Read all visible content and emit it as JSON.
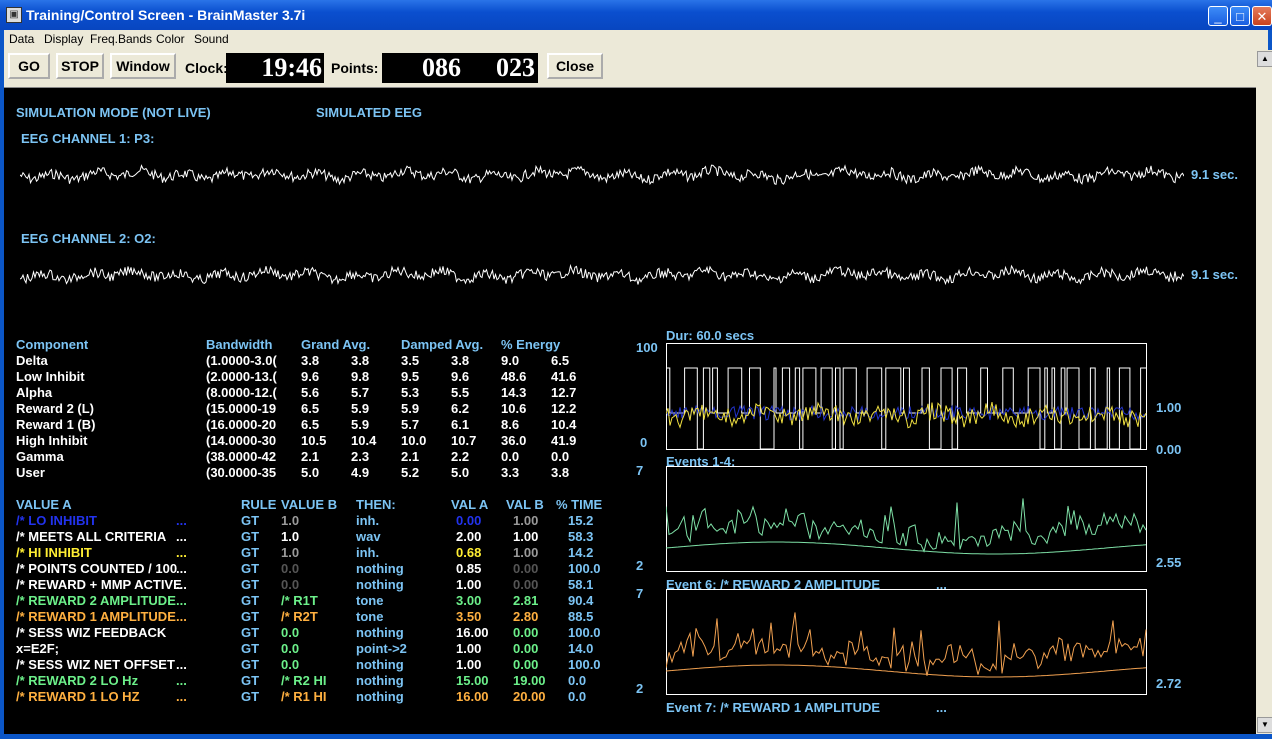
{
  "window": {
    "title": "Training/Control Screen - BrainMaster 3.7i",
    "min_glyph": "_",
    "max_glyph": "□",
    "close_glyph": "✕"
  },
  "menu": [
    "Data",
    "Display",
    "Freq.Bands",
    "Color",
    "Sound"
  ],
  "toolbar": {
    "go": "GO",
    "stop": "STOP",
    "window": "Window",
    "clock_label": "Clock:",
    "clock_value": "19:46",
    "points_label": "Points:",
    "points_a": "086",
    "points_b": "023",
    "close": "Close"
  },
  "status": {
    "mode": "SIMULATION MODE (NOT LIVE)",
    "source": "SIMULATED EEG"
  },
  "eeg": [
    {
      "label": "EEG CHANNEL 1: P3:",
      "duration": "9.1 sec."
    },
    {
      "label": "EEG CHANNEL 2: O2:",
      "duration": "9.1 sec."
    }
  ],
  "components": {
    "headers": [
      "Component",
      "Bandwidth",
      "Grand Avg.",
      "Damped Avg.",
      "% Energy"
    ],
    "rows": [
      {
        "name": "Delta",
        "band": "(1.0000-3.0(",
        "ga1": "3.8",
        "ga2": "3.8",
        "da1": "3.5",
        "da2": "3.8",
        "e1": "9.0",
        "e2": "6.5"
      },
      {
        "name": "Low Inhibit",
        "band": "(2.0000-13.(",
        "ga1": "9.6",
        "ga2": "9.8",
        "da1": "9.5",
        "da2": "9.6",
        "e1": "48.6",
        "e2": "41.6"
      },
      {
        "name": "Alpha",
        "band": "(8.0000-12.(",
        "ga1": "5.6",
        "ga2": "5.7",
        "da1": "5.3",
        "da2": "5.5",
        "e1": "14.3",
        "e2": "12.7"
      },
      {
        "name": "Reward 2 (L)",
        "band": "(15.0000-19",
        "ga1": "6.5",
        "ga2": "5.9",
        "da1": "5.9",
        "da2": "6.2",
        "e1": "10.6",
        "e2": "12.2"
      },
      {
        "name": "Reward 1 (B)",
        "band": "(16.0000-20",
        "ga1": "6.5",
        "ga2": "5.9",
        "da1": "5.7",
        "da2": "6.1",
        "e1": "8.6",
        "e2": "10.4"
      },
      {
        "name": "High Inhibit",
        "band": "(14.0000-30",
        "ga1": "10.5",
        "ga2": "10.4",
        "da1": "10.0",
        "da2": "10.7",
        "e1": "36.0",
        "e2": "41.9"
      },
      {
        "name": "Gamma",
        "band": "(38.0000-42",
        "ga1": "2.1",
        "ga2": "2.3",
        "da1": "2.1",
        "da2": "2.2",
        "e1": "0.0",
        "e2": "0.0"
      },
      {
        "name": "User",
        "band": "(30.0000-35",
        "ga1": "5.0",
        "ga2": "4.9",
        "da1": "5.2",
        "da2": "5.0",
        "e1": "3.3",
        "e2": "3.8"
      }
    ]
  },
  "rules": {
    "headers": [
      "VALUE A",
      "RULE",
      "VALUE B",
      "THEN:",
      "VAL A",
      "VAL B",
      "% TIME"
    ],
    "rows": [
      {
        "a": "/* LO INHIBIT",
        "dots": "...",
        "rule": "GT",
        "b": "1.0",
        "then": "inh.",
        "va": "0.00",
        "vb": "1.00",
        "pt": "15.2",
        "ca": "#2233ee",
        "cb": "#9a9a9a",
        "cva": "#2233ee",
        "cvb": "#9a9a9a"
      },
      {
        "a": "/* MEETS ALL  CRITERIA",
        "dots": "...",
        "rule": "GT",
        "b": "1.0",
        "then": "wav",
        "va": "2.00",
        "vb": "1.00",
        "pt": "58.3",
        "ca": "#ffffff",
        "cb": "#ffffff",
        "cva": "#ffffff",
        "cvb": "#ffffff"
      },
      {
        "a": "/* HI INHIBIT",
        "dots": "...",
        "rule": "GT",
        "b": "1.0",
        "then": "inh.",
        "va": "0.68",
        "vb": "1.00",
        "pt": "14.2",
        "ca": "#ffee33",
        "cb": "#9a9a9a",
        "cva": "#ffee33",
        "cvb": "#9a9a9a"
      },
      {
        "a": "/* POINTS COUNTED / 100",
        "dots": "...",
        "rule": "GT",
        "b": "0.0",
        "then": "nothing",
        "va": "0.85",
        "vb": "0.00",
        "pt": "100.0",
        "ca": "#ffffff",
        "cb": "#555555",
        "cva": "#ffffff",
        "cvb": "#555555"
      },
      {
        "a": "/* REWARD + MMP ACTIVE",
        "dots": "...",
        "rule": "GT",
        "b": "0.0",
        "then": "nothing",
        "va": "1.00",
        "vb": "0.00",
        "pt": "58.1",
        "ca": "#ffffff",
        "cb": "#555555",
        "cva": "#ffffff",
        "cvb": "#555555"
      },
      {
        "a": "/* REWARD 2 AMPLITUDE",
        "dots": "...",
        "rule": "GT",
        "b": "/* R1T",
        "then": "tone",
        "va": "3.00",
        "vb": "2.81",
        "pt": "90.4",
        "ca": "#6cf08a",
        "cb": "#6cf08a",
        "cva": "#6cf08a",
        "cvb": "#6cf08a"
      },
      {
        "a": "/* REWARD 1 AMPLITUDE",
        "dots": "...",
        "rule": "GT",
        "b": "/* R2T",
        "then": "tone",
        "va": "3.50",
        "vb": "2.80",
        "pt": "88.5",
        "ca": "#ffb040",
        "cb": "#ffb040",
        "cva": "#ffb040",
        "cvb": "#ffb040"
      },
      {
        "a": "/* SESS WIZ FEEDBACK",
        "dots": "",
        "rule": "GT",
        "b": "0.0",
        "then": "nothing",
        "va": "16.00",
        "vb": "0.00",
        "pt": "100.0",
        "ca": "#ffffff",
        "cb": "#6cf08a",
        "cva": "#ffffff",
        "cvb": "#6cf08a"
      },
      {
        "a": "x=E2F;",
        "dots": "",
        "rule": "GT",
        "b": "0.0",
        "then": "point->2",
        "va": "1.00",
        "vb": "0.00",
        "pt": "14.0",
        "ca": "#ffffff",
        "cb": "#6cf08a",
        "cva": "#ffffff",
        "cvb": "#6cf08a"
      },
      {
        "a": "/* SESS WIZ NET OFFSET",
        "dots": "...",
        "rule": "GT",
        "b": "0.0",
        "then": "nothing",
        "va": "1.00",
        "vb": "0.00",
        "pt": "100.0",
        "ca": "#ffffff",
        "cb": "#6cf08a",
        "cva": "#ffffff",
        "cvb": "#6cf08a"
      },
      {
        "a": "/* REWARD 2 LO Hz",
        "dots": "...",
        "rule": "GT",
        "b": "/* R2 HI",
        "then": "nothing",
        "va": "15.00",
        "vb": "19.00",
        "pt": "0.0",
        "ca": "#6cf08a",
        "cb": "#6cf08a",
        "cva": "#6cf08a",
        "cvb": "#6cf08a"
      },
      {
        "a": "/* REWARD 1 LO HZ",
        "dots": "...",
        "rule": "GT",
        "b": "/* R1 HI",
        "then": "nothing",
        "va": "16.00",
        "vb": "20.00",
        "pt": "0.0",
        "ca": "#ffb040",
        "cb": "#ffb040",
        "cva": "#ffb040",
        "cvb": "#ffb040"
      }
    ]
  },
  "charts": {
    "top": {
      "title": "Dur: 60.0 secs",
      "y_max": "100",
      "y_min": "0",
      "right_a": "1.00",
      "right_b": "0.00"
    },
    "mid": {
      "title": "Events 1-4:",
      "y_max": "7",
      "y_min": "2",
      "right": "2.55"
    },
    "bot": {
      "title": "Event 6: /* REWARD 2 AMPLITUDE",
      "dots": "...",
      "y_max": "7",
      "y_min": "2",
      "right": "2.72",
      "footer": "Event 7: /* REWARD 1 AMPLITUDE",
      "footer_dots": "..."
    }
  },
  "colors": {
    "label_blue": "#7cc4f4",
    "trace_white": "#ffffff",
    "trace_yellow": "#f0e040",
    "trace_navy": "#2233cc",
    "trace_green": "#7ee0a6",
    "trace_orange": "#f0a050"
  }
}
